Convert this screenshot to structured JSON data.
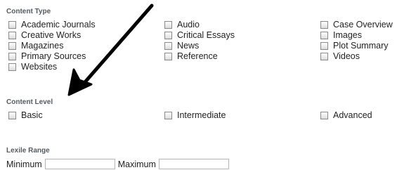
{
  "content_type": {
    "title": "Content Type",
    "options": [
      "Academic Journals",
      "Audio",
      "Case Overview",
      "Creative Works",
      "Critical Essays",
      "Images",
      "Magazines",
      "News",
      "Plot Summary",
      "Primary Sources",
      "Reference",
      "Videos",
      "Websites"
    ]
  },
  "content_level": {
    "title": "Content Level",
    "options": [
      "Basic",
      "Intermediate",
      "Advanced"
    ]
  },
  "lexile_range": {
    "title": "Lexile Range",
    "minimum_label": "Minimum",
    "maximum_label": "Maximum",
    "minimum_value": "",
    "maximum_value": ""
  },
  "annotation": {
    "type": "arrow-icon",
    "color": "#000000"
  }
}
